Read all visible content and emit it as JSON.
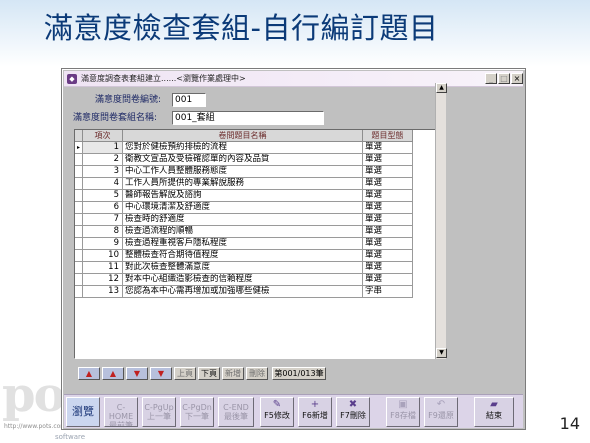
{
  "slide": {
    "title": "滿意度檢查套組-自行編訂題目",
    "watermark": "pot",
    "watermark_url": "http://www.pots.com",
    "watermark_software": "software",
    "page_number": "14"
  },
  "window": {
    "title": "滿意度調查表套組建立......<瀏覽作業處理中>",
    "buttons": {
      "minimize": "_",
      "restore": "□",
      "close": "×"
    },
    "fields": {
      "questionnaire_no_label": "滿意度問卷編號:",
      "questionnaire_no_value": "001",
      "set_name_label": "滿意度問卷套組名稱:",
      "set_name_value": "001_套組"
    },
    "grid": {
      "columns": [
        "項次",
        "卷問題目名稱",
        "題目型態"
      ],
      "current_row_marker": "▸",
      "rows": [
        {
          "no": "1",
          "title": "您對於健檢預約排檢的流程",
          "type": "單選"
        },
        {
          "no": "2",
          "title": "衛教文宣品及受檢確認單的內容及品質",
          "type": "單選"
        },
        {
          "no": "3",
          "title": "中心工作人員整體服務態度",
          "type": "單選"
        },
        {
          "no": "4",
          "title": "工作人員所提供的專業解說服務",
          "type": "單選"
        },
        {
          "no": "5",
          "title": "醫師報告解說及諮詢",
          "type": "單選"
        },
        {
          "no": "6",
          "title": "中心環境清潔及舒適度",
          "type": "單選"
        },
        {
          "no": "7",
          "title": "檢查時的舒適度",
          "type": "單選"
        },
        {
          "no": "8",
          "title": "檢查過流程的順暢",
          "type": "單選"
        },
        {
          "no": "9",
          "title": "檢查過程重視客戶隱私程度",
          "type": "單選"
        },
        {
          "no": "10",
          "title": "整體檢查符合期待值程度",
          "type": "單選"
        },
        {
          "no": "11",
          "title": "對此次檢查整體滿意度",
          "type": "單選"
        },
        {
          "no": "12",
          "title": "對本中心組織造影檢查的信賴程度",
          "type": "單選"
        },
        {
          "no": "13",
          "title": "您認為本中心需再增加或加強哪些健檢",
          "type": "字串"
        }
      ]
    },
    "nav": {
      "first": "▲",
      "prev": "▲",
      "next": "▼",
      "last": "▼",
      "upper": "上頁",
      "lower": "下頁",
      "add": "新增",
      "delete": "刪除",
      "counter": "第001/013筆"
    },
    "toolbar": [
      {
        "key": "browse",
        "label": "瀏覽",
        "icon": "browse-icon"
      },
      {
        "key": "home",
        "line1": "C-HOME",
        "line2": "最前筆",
        "icon": "none"
      },
      {
        "key": "pgup",
        "line1": "C-PgUp",
        "line2": "上一筆",
        "icon": "none"
      },
      {
        "key": "pgdn",
        "line1": "C-PgDn",
        "line2": "下一筆",
        "icon": "none"
      },
      {
        "key": "end",
        "line1": "C-END",
        "line2": "最後筆",
        "icon": "none"
      },
      {
        "key": "f5",
        "label": "F5修改",
        "icon": "edit-icon"
      },
      {
        "key": "f6",
        "label": "F6新增",
        "icon": "add-icon"
      },
      {
        "key": "f7",
        "label": "F7刪除",
        "icon": "delete-icon"
      },
      {
        "key": "f8",
        "label": "F8存檔",
        "icon": "save-icon"
      },
      {
        "key": "f9",
        "label": "F9還原",
        "icon": "undo-icon"
      },
      {
        "key": "exit",
        "label": "結束",
        "icon": "folder-icon"
      }
    ]
  }
}
